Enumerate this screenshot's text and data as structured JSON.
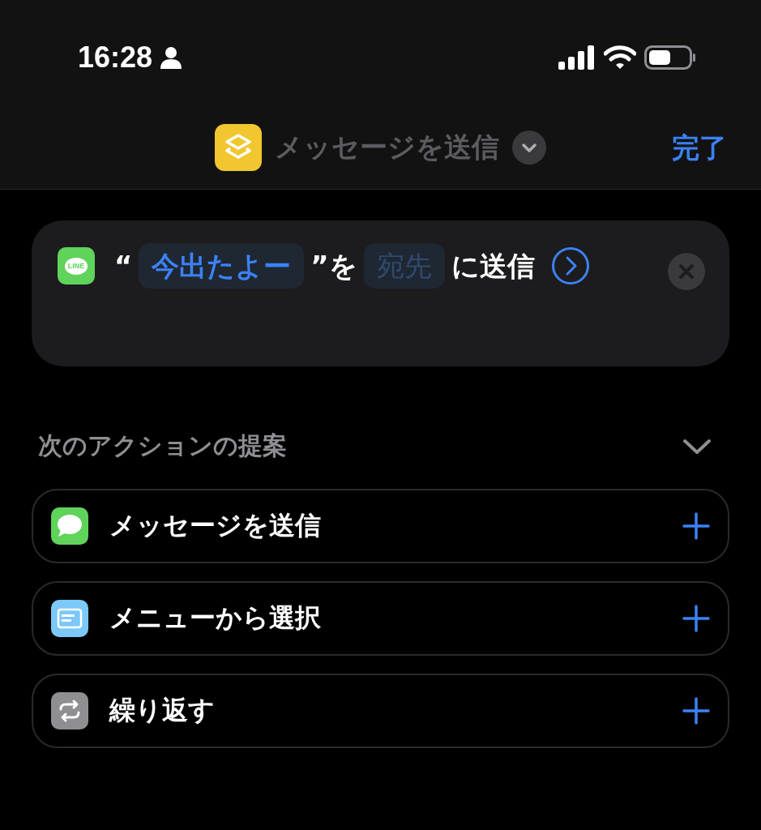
{
  "status_bar": {
    "time": "16:28"
  },
  "nav": {
    "title": "メッセージを送信",
    "done": "完了"
  },
  "action": {
    "app_label": "LINE",
    "tokens": [
      {
        "kind": "text",
        "text": "“"
      },
      {
        "kind": "variable",
        "text": "今出たよー"
      },
      {
        "kind": "text",
        "text": "”を"
      },
      {
        "kind": "placeholder",
        "text": "宛先"
      },
      {
        "kind": "text",
        "text": "に送信"
      }
    ]
  },
  "suggestions": {
    "title": "次のアクションの提案",
    "expanded": true,
    "items": [
      {
        "kind": "messages",
        "label": "メッセージを送信",
        "color": "#5fd35a"
      },
      {
        "kind": "menu",
        "label": "メニューから選択",
        "color": "#7cc8f8"
      },
      {
        "kind": "repeat",
        "label": "繰り返す",
        "color": "#8e8e93"
      }
    ]
  }
}
